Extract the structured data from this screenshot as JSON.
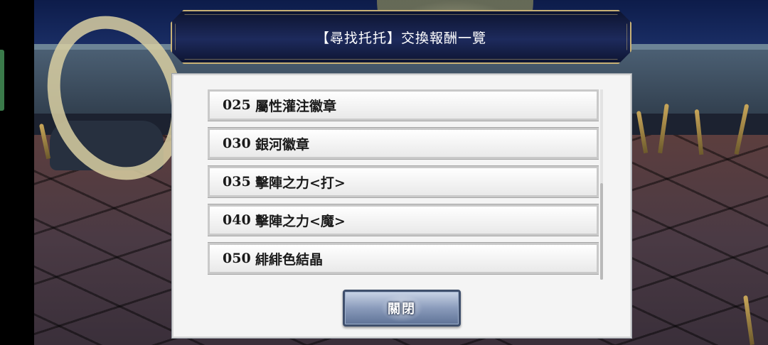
{
  "title": "【尋找托托】交換報酬一覽",
  "items": [
    {
      "number": "025",
      "name": "屬性灌注徽章"
    },
    {
      "number": "030",
      "name": "銀河徽章"
    },
    {
      "number": "035",
      "name": "擊陣之力<打>"
    },
    {
      "number": "040",
      "name": "擊陣之力<魔>"
    },
    {
      "number": "050",
      "name": "緋緋色結晶"
    }
  ],
  "close_label": "關閉"
}
